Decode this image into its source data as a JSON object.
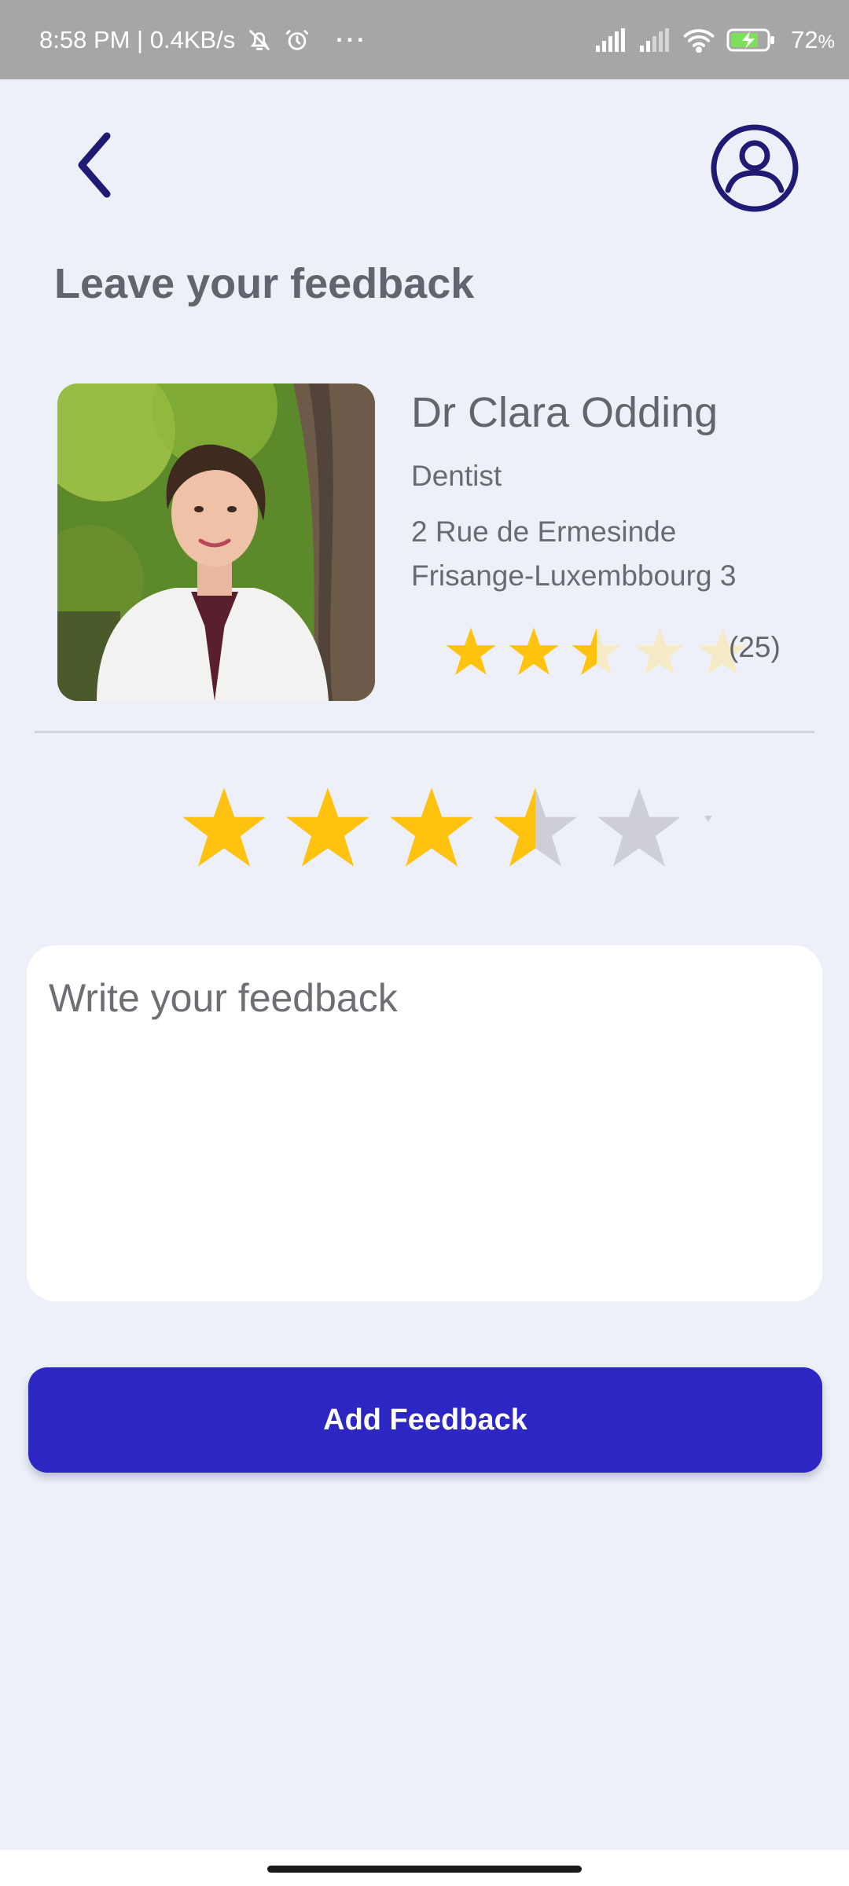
{
  "status_bar": {
    "time_speed": "8:58 PM | 0.4KB/s",
    "dots": "···",
    "battery": "72",
    "battery_unit": "%"
  },
  "header": {
    "back_icon": "chevron-left-icon",
    "profile_icon": "user-circle-icon",
    "title": "Leave your feedback"
  },
  "doctor": {
    "name": "Dr Clara Odding",
    "specialty": "Dentist",
    "address_line1": "2 Rue de Ermesinde",
    "address_line2": "Frisange-Luxembbourg 3",
    "rating": 2.5,
    "rating_max": 5,
    "review_count": "(25)"
  },
  "user_rating": {
    "value": 3.5,
    "max": 5
  },
  "feedback": {
    "placeholder": "Write your feedback",
    "value": ""
  },
  "submit": {
    "label": "Add Feedback"
  },
  "colors": {
    "background": "#edf0f8",
    "accent": "#2c27c3",
    "icon_dark": "#1f1a73",
    "star_filled": "#ffc20e",
    "star_small_empty": "#f7ebc7",
    "star_big_empty": "#cdced6",
    "text": "#62646f"
  }
}
